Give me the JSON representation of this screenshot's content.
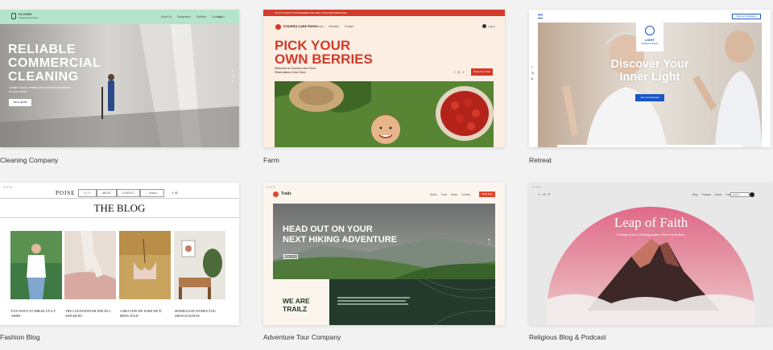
{
  "templates": [
    {
      "caption": "Cleaning Company",
      "logo": "PLOVER",
      "logo_sub": "Cleaning Services",
      "nav": [
        "About Us",
        "Workplaces",
        "Facilities",
        "Contacts"
      ],
      "login": "Log In",
      "headline": [
        "RELIABLE",
        "COMMERCIAL",
        "CLEANING"
      ],
      "subtext": "Create a clean, healthy work environment tailored for your needs.",
      "cta": "Get a Quote"
    },
    {
      "caption": "Farm",
      "banner": "CLICK TO EDIT THIS BANNER AND ADD YOUR OWN MESSAGE",
      "logo": "Country Lane Farm",
      "nav": [
        "About",
        "Activities",
        "Contact"
      ],
      "login": "Log In",
      "headline": [
        "PICK YOUR",
        "OWN BERRIES"
      ],
      "subtext": "Welcome to Country Lane Farm. Reservations Now Open",
      "cta": "Book Your Visit"
    },
    {
      "caption": "Retreat",
      "logo": "LIGHT",
      "logo_sub": "Meditation Retreat",
      "cta_top": "Discover Meditation",
      "headline": [
        "Discover Your",
        "Inner Light"
      ],
      "cta": "Join Our Retreats"
    },
    {
      "caption": "Fashion Blog",
      "logo": "POISE",
      "nav": [
        "BLOG",
        "ABOUT",
        "CONTACT"
      ],
      "search": "Search...",
      "headline": "THE BLOG",
      "posts": [
        "FUN WAYS TO DRESS UP A T-SHIRT",
        "THE LOUNGEWEAR PIECES I SWEAR BY",
        "5 BRA TIPS WE WISH WE'D BEEN TOLD",
        "HOMEGOOD STORES YOU SHOULD KNOW"
      ]
    },
    {
      "caption": "Adventure Tour Company",
      "logo": "Trailz",
      "nav": [
        "About",
        "Tours",
        "News",
        "Contact"
      ],
      "cta_top": "Book Now",
      "headline": [
        "HEAD OUT ON YOUR",
        "NEXT HIKING ADVENTURE"
      ],
      "cta": "Book a Tour",
      "footer_headline": [
        "WE ARE",
        "TRAILZ"
      ]
    },
    {
      "caption": "Religious Blog & Podcast",
      "logo": "L·O·F",
      "nav": [
        "Blog",
        "Podcast",
        "About",
        "Contact"
      ],
      "search": "Search...",
      "headline": "Leap of Faith",
      "subtext": "Trusting God is a lifelong journey. Don't travel alone."
    }
  ],
  "colors": {
    "page_bg": "#f2f2f2",
    "plover_green": "#b5e3cb",
    "farm_red": "#d23b2b",
    "farm_bg": "#fdeee3",
    "retreat_blue": "#1a56c5",
    "trailz_red": "#e1452f",
    "trailz_dark": "#233a2c",
    "lof_pink": "#e06a89"
  }
}
